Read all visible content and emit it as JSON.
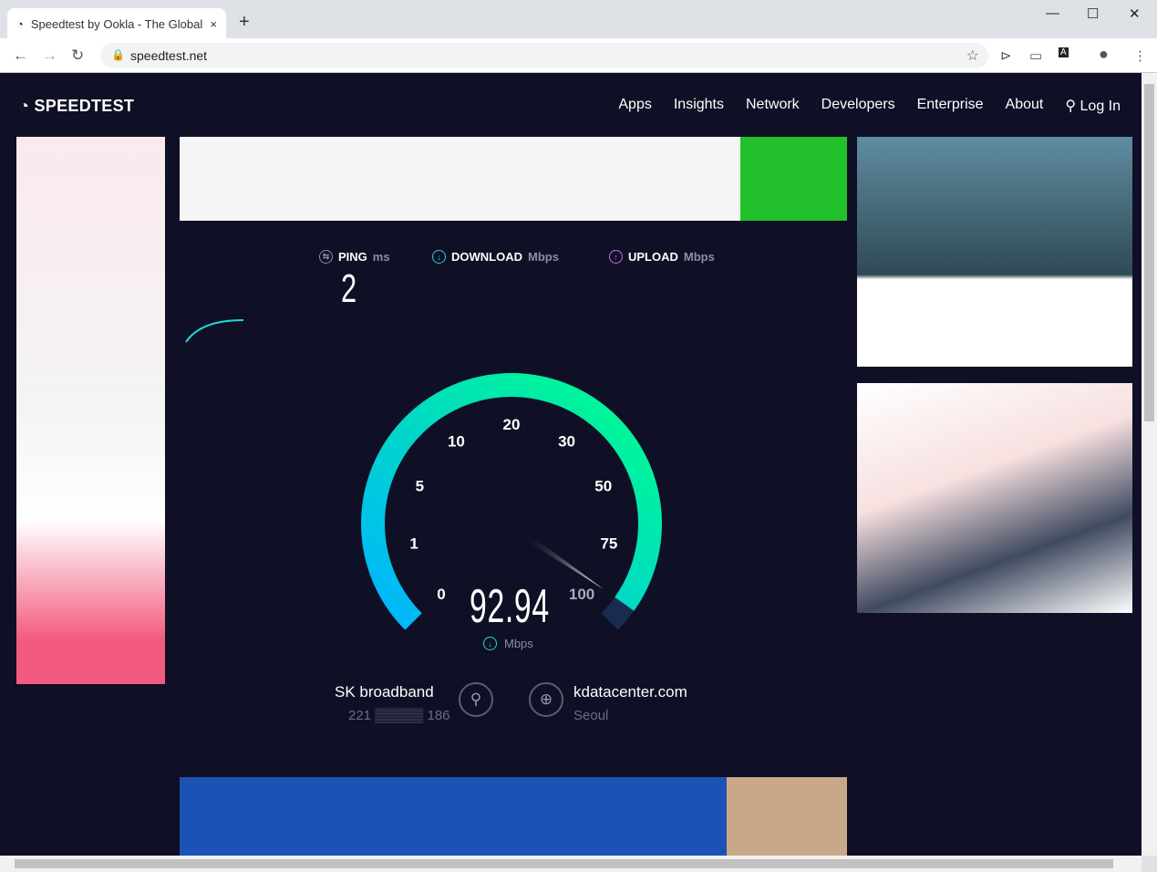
{
  "browser": {
    "tab_title": "Speedtest by Ookla - The Global",
    "url": "speedtest.net",
    "new_tab": "+",
    "close_tab": "×"
  },
  "site": {
    "logo": "SPEEDTEST",
    "nav": [
      "Apps",
      "Insights",
      "Network",
      "Developers",
      "Enterprise",
      "About",
      "Log In"
    ]
  },
  "results": {
    "ping": {
      "label": "PING",
      "unit": "ms",
      "value": "2"
    },
    "download": {
      "label": "DOWNLOAD",
      "unit": "Mbps"
    },
    "upload": {
      "label": "UPLOAD",
      "unit": "Mbps"
    }
  },
  "gauge": {
    "ticks": [
      "0",
      "1",
      "5",
      "10",
      "20",
      "30",
      "50",
      "75",
      "100"
    ],
    "value": "92.94",
    "unit": "Mbps",
    "needle_value": 92.94,
    "colors": {
      "start": "#00c8ff",
      "end": "#00ff8a",
      "rest": "#1a2a50"
    }
  },
  "provider": {
    "name": "SK broadband",
    "ip": "221 ▒▒▒▒▒ 186"
  },
  "server": {
    "name": "kdatacenter.com",
    "location": "Seoul"
  }
}
